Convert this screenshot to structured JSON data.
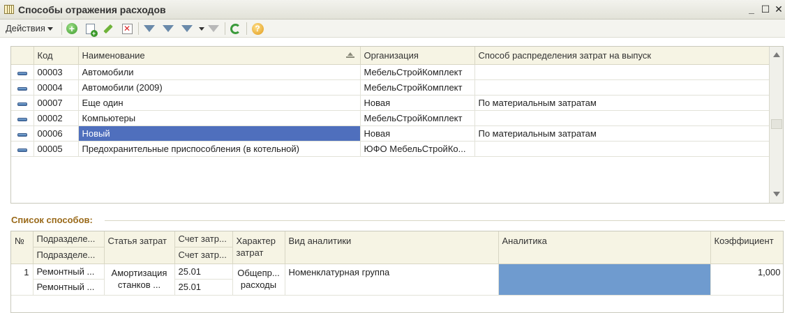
{
  "window": {
    "title": "Способы отражения расходов",
    "minimize_label": "_",
    "maximize_label": "☐",
    "close_label": "✕"
  },
  "toolbar": {
    "actions_label": "Действия",
    "help_label": "?"
  },
  "top_table": {
    "columns": [
      "Код",
      "Наименование",
      "Организация",
      "Способ распределения затрат на выпуск"
    ],
    "rows": [
      {
        "code": "00003",
        "name": "Автомобили",
        "org": "МебельСтройКомплект",
        "method": ""
      },
      {
        "code": "00004",
        "name": "Автомобили (2009)",
        "org": "МебельСтройКомплект",
        "method": ""
      },
      {
        "code": "00007",
        "name": "Еще один",
        "org": "Новая",
        "method": "По материальным затратам"
      },
      {
        "code": "00002",
        "name": "Компьютеры",
        "org": "МебельСтройКомплект",
        "method": ""
      },
      {
        "code": "00006",
        "name": "Новый",
        "org": "Новая",
        "method": "По материальным затратам"
      },
      {
        "code": "00005",
        "name": "Предохранительные приспособления (в котельной)",
        "org": "ЮФО МебельСтройКо...",
        "method": ""
      }
    ],
    "selected_row_index": 4
  },
  "section_label": "Список способов:",
  "bottom_table": {
    "columns": {
      "num": "№",
      "dept_1": "Подразделе...",
      "dept_2": "Подразделе...",
      "cost_item": "Статья затрат",
      "account_1": "Счет затр...",
      "account_2": "Счет затр...",
      "nature": "Характер затрат",
      "analytics_type": "Вид аналитики",
      "analytics": "Аналитика",
      "coefficient": "Коэффициент"
    },
    "rows": [
      {
        "num": "1",
        "dept_1": "Ремонтный ...",
        "dept_2": "Ремонтный ...",
        "cost_item": "Амортизация станков ...",
        "account_1": "25.01",
        "account_2": "25.01",
        "nature": "Общепр... расходы",
        "analytics_type": "Номенклатурная группа",
        "analytics": "",
        "coefficient": "1,000"
      }
    ]
  },
  "colors": {
    "selection": "#4f6fbd",
    "analytics_cell": "#6f9bcf",
    "section_label": "#9a6a1a",
    "header_bg": "#f6f4e4"
  }
}
